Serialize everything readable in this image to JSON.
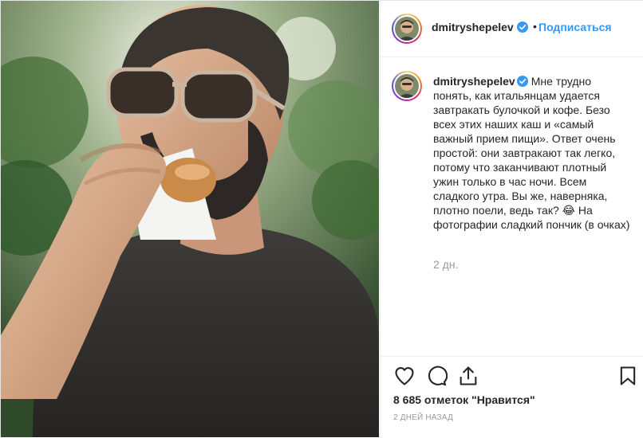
{
  "post": {
    "username": "dmitryshepelev",
    "follow_label": "Подписаться",
    "separator": "•",
    "caption": "Мне трудно понять, как итальянцам удается завтракать булочкой и кофе. Безо всех этих наших каш и «самый важный прием пищи». Ответ очень простой: они завтракают так легко, потому что заканчивают плотный ужин только в час ночи. Всем сладкого утра. Вы же, наверняка, плотно поели, ведь так? 😂 На фотографии сладкий пончик (в очках)",
    "caption_time": "2 дн.",
    "likes_text": "8 685 отметок \"Нравится\"",
    "date_text": "2 ДНЕЙ НАЗАД"
  },
  "icons": {
    "like": "heart-icon",
    "comment": "comment-icon",
    "share": "share-icon",
    "save": "bookmark-icon",
    "verified": "verified-badge-icon"
  },
  "colors": {
    "link": "#3897f0",
    "text": "#262626",
    "muted": "#999999",
    "border": "#efefef"
  }
}
